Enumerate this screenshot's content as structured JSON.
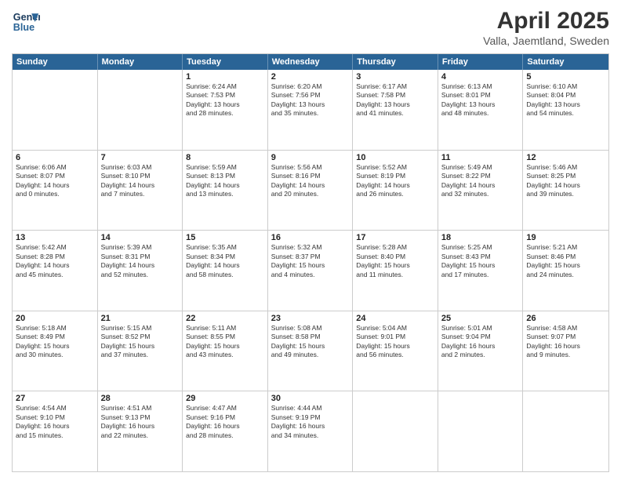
{
  "header": {
    "logo_line1": "General",
    "logo_line2": "Blue",
    "title": "April 2025",
    "subtitle": "Valla, Jaemtland, Sweden"
  },
  "days_of_week": [
    "Sunday",
    "Monday",
    "Tuesday",
    "Wednesday",
    "Thursday",
    "Friday",
    "Saturday"
  ],
  "weeks": [
    [
      {
        "day": "",
        "lines": []
      },
      {
        "day": "",
        "lines": []
      },
      {
        "day": "1",
        "lines": [
          "Sunrise: 6:24 AM",
          "Sunset: 7:53 PM",
          "Daylight: 13 hours",
          "and 28 minutes."
        ]
      },
      {
        "day": "2",
        "lines": [
          "Sunrise: 6:20 AM",
          "Sunset: 7:56 PM",
          "Daylight: 13 hours",
          "and 35 minutes."
        ]
      },
      {
        "day": "3",
        "lines": [
          "Sunrise: 6:17 AM",
          "Sunset: 7:58 PM",
          "Daylight: 13 hours",
          "and 41 minutes."
        ]
      },
      {
        "day": "4",
        "lines": [
          "Sunrise: 6:13 AM",
          "Sunset: 8:01 PM",
          "Daylight: 13 hours",
          "and 48 minutes."
        ]
      },
      {
        "day": "5",
        "lines": [
          "Sunrise: 6:10 AM",
          "Sunset: 8:04 PM",
          "Daylight: 13 hours",
          "and 54 minutes."
        ]
      }
    ],
    [
      {
        "day": "6",
        "lines": [
          "Sunrise: 6:06 AM",
          "Sunset: 8:07 PM",
          "Daylight: 14 hours",
          "and 0 minutes."
        ]
      },
      {
        "day": "7",
        "lines": [
          "Sunrise: 6:03 AM",
          "Sunset: 8:10 PM",
          "Daylight: 14 hours",
          "and 7 minutes."
        ]
      },
      {
        "day": "8",
        "lines": [
          "Sunrise: 5:59 AM",
          "Sunset: 8:13 PM",
          "Daylight: 14 hours",
          "and 13 minutes."
        ]
      },
      {
        "day": "9",
        "lines": [
          "Sunrise: 5:56 AM",
          "Sunset: 8:16 PM",
          "Daylight: 14 hours",
          "and 20 minutes."
        ]
      },
      {
        "day": "10",
        "lines": [
          "Sunrise: 5:52 AM",
          "Sunset: 8:19 PM",
          "Daylight: 14 hours",
          "and 26 minutes."
        ]
      },
      {
        "day": "11",
        "lines": [
          "Sunrise: 5:49 AM",
          "Sunset: 8:22 PM",
          "Daylight: 14 hours",
          "and 32 minutes."
        ]
      },
      {
        "day": "12",
        "lines": [
          "Sunrise: 5:46 AM",
          "Sunset: 8:25 PM",
          "Daylight: 14 hours",
          "and 39 minutes."
        ]
      }
    ],
    [
      {
        "day": "13",
        "lines": [
          "Sunrise: 5:42 AM",
          "Sunset: 8:28 PM",
          "Daylight: 14 hours",
          "and 45 minutes."
        ]
      },
      {
        "day": "14",
        "lines": [
          "Sunrise: 5:39 AM",
          "Sunset: 8:31 PM",
          "Daylight: 14 hours",
          "and 52 minutes."
        ]
      },
      {
        "day": "15",
        "lines": [
          "Sunrise: 5:35 AM",
          "Sunset: 8:34 PM",
          "Daylight: 14 hours",
          "and 58 minutes."
        ]
      },
      {
        "day": "16",
        "lines": [
          "Sunrise: 5:32 AM",
          "Sunset: 8:37 PM",
          "Daylight: 15 hours",
          "and 4 minutes."
        ]
      },
      {
        "day": "17",
        "lines": [
          "Sunrise: 5:28 AM",
          "Sunset: 8:40 PM",
          "Daylight: 15 hours",
          "and 11 minutes."
        ]
      },
      {
        "day": "18",
        "lines": [
          "Sunrise: 5:25 AM",
          "Sunset: 8:43 PM",
          "Daylight: 15 hours",
          "and 17 minutes."
        ]
      },
      {
        "day": "19",
        "lines": [
          "Sunrise: 5:21 AM",
          "Sunset: 8:46 PM",
          "Daylight: 15 hours",
          "and 24 minutes."
        ]
      }
    ],
    [
      {
        "day": "20",
        "lines": [
          "Sunrise: 5:18 AM",
          "Sunset: 8:49 PM",
          "Daylight: 15 hours",
          "and 30 minutes."
        ]
      },
      {
        "day": "21",
        "lines": [
          "Sunrise: 5:15 AM",
          "Sunset: 8:52 PM",
          "Daylight: 15 hours",
          "and 37 minutes."
        ]
      },
      {
        "day": "22",
        "lines": [
          "Sunrise: 5:11 AM",
          "Sunset: 8:55 PM",
          "Daylight: 15 hours",
          "and 43 minutes."
        ]
      },
      {
        "day": "23",
        "lines": [
          "Sunrise: 5:08 AM",
          "Sunset: 8:58 PM",
          "Daylight: 15 hours",
          "and 49 minutes."
        ]
      },
      {
        "day": "24",
        "lines": [
          "Sunrise: 5:04 AM",
          "Sunset: 9:01 PM",
          "Daylight: 15 hours",
          "and 56 minutes."
        ]
      },
      {
        "day": "25",
        "lines": [
          "Sunrise: 5:01 AM",
          "Sunset: 9:04 PM",
          "Daylight: 16 hours",
          "and 2 minutes."
        ]
      },
      {
        "day": "26",
        "lines": [
          "Sunrise: 4:58 AM",
          "Sunset: 9:07 PM",
          "Daylight: 16 hours",
          "and 9 minutes."
        ]
      }
    ],
    [
      {
        "day": "27",
        "lines": [
          "Sunrise: 4:54 AM",
          "Sunset: 9:10 PM",
          "Daylight: 16 hours",
          "and 15 minutes."
        ]
      },
      {
        "day": "28",
        "lines": [
          "Sunrise: 4:51 AM",
          "Sunset: 9:13 PM",
          "Daylight: 16 hours",
          "and 22 minutes."
        ]
      },
      {
        "day": "29",
        "lines": [
          "Sunrise: 4:47 AM",
          "Sunset: 9:16 PM",
          "Daylight: 16 hours",
          "and 28 minutes."
        ]
      },
      {
        "day": "30",
        "lines": [
          "Sunrise: 4:44 AM",
          "Sunset: 9:19 PM",
          "Daylight: 16 hours",
          "and 34 minutes."
        ]
      },
      {
        "day": "",
        "lines": []
      },
      {
        "day": "",
        "lines": []
      },
      {
        "day": "",
        "lines": []
      }
    ]
  ]
}
